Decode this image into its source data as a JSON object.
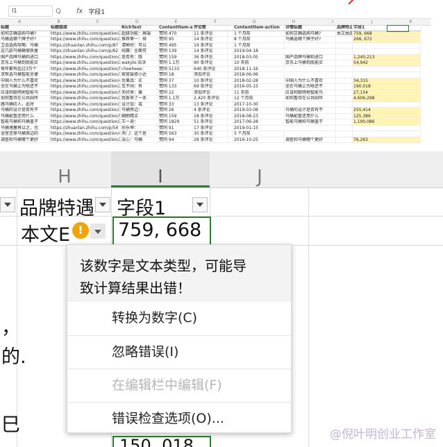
{
  "top": {
    "name_box": "I1",
    "fx_symbol": "fx",
    "fx_search": "Q",
    "formula_value": "字段1",
    "col_letters": [
      "A",
      "B",
      "C",
      "D",
      "E",
      "F",
      "G",
      "H",
      "I",
      "J",
      "K"
    ],
    "table_headers": [
      "标题",
      "标题链接",
      "RichText",
      "ContentItem-ac",
      "评论数",
      "",
      "ContentItem-action",
      "详情标题",
      "",
      "品牌特点",
      "字段1"
    ],
    "rows": [
      [
        "如何正确选购马桶?",
        "https://www.zhihu.com/question/2",
        "超级功能：高端",
        "赞同 470",
        "11 条评论",
        "",
        "1 个月前",
        "如何正确选购马桶?",
        "本文由品",
        "759, 668"
      ],
      [
        "马桶选哪个牌子好?",
        "https://www.zhihu.com/question/2",
        "推荐第一：排",
        "赞同 95",
        "14 条评论",
        "",
        "8 个月前",
        "马桶选哪个牌子好?",
        "",
        "266, 672"
      ],
      [
        "卫浴选购攻略：马桶",
        "https://zhuanlan.zhihu.com/p/87",
        "清晰时：可以",
        "赞同 495",
        "19 条评论",
        "",
        "1 个月前",
        "",
        "",
        ""
      ],
      [
        "这几款马桶确保质量",
        "https://zhuanlan.zhihu.com/p/62",
        "纯赛：全面可",
        "赞同 139",
        "14 条评论",
        "",
        "2019-04-18",
        "",
        "",
        ""
      ],
      [
        "国产品牌马桶和进口",
        "https://www.zhihu.com/question/3",
        "是否有：既",
        "赞同 159",
        "36 条评论",
        "",
        "2018-03-05",
        "国产品牌马桶和进口",
        "",
        "1,240,213"
      ],
      [
        "京东上马桶到底能买",
        "https://www.zhihu.com/question/2",
        "wakyto:告诉",
        "赞同 1.1万",
        "90 条评论",
        "",
        "10 天前",
        "京东上马桶到底能买",
        "",
        "54,942"
      ],
      [
        "每年都有超过3万个",
        "https://www.zhihu.com/question/50",
        "cheeheee：",
        "赞同 5133",
        "640 条评论",
        "",
        "2018-11-16",
        "",
        "",
        ""
      ],
      [
        "求帮选马桶智能坐便",
        "https://www.zhihu.com/question/37",
        "家居装修小达",
        "赞同 18",
        "添加评论",
        "",
        "2018-06-06",
        "",
        "",
        ""
      ],
      [
        "中国人为什么不喜欢",
        "https://www.zhihu.com/question/4",
        "优果品：买",
        "赞同 37",
        "10 条评论",
        "",
        "2018-02-28",
        "中国人为什么不喜欢",
        "",
        "34,315"
      ],
      [
        "坐在马桶上为啥还不",
        "https://www.zhihu.com/question/2",
        "车不闲：有",
        "赞同 133",
        "69 条评论",
        "",
        "2016-05-15",
        "坐在马桶上为啥还不",
        "",
        "190,018"
      ],
      [
        "应该和聪明地智能马",
        "https://www.zhihu.com/question/5",
        "天好来：展",
        "赞同 22",
        "添加评论",
        "",
        "11 天前",
        "应该和聪明地智能马",
        "",
        "27,154"
      ],
      [
        "如何看待在公共厕所",
        "https://www.zhihu.com/question/2",
        "我家来了一条",
        "赞同 1.1万",
        "2,420 条评论",
        "",
        "12 个月前",
        "如何看待在公共厕所",
        "",
        "4,606,298"
      ],
      [
        "路马桶防人，此时",
        "https://www.zhihu.com/question/3",
        "设计加：或",
        "赞同 33",
        "13 条评论",
        "",
        "2017-10-30",
        "",
        "",
        ""
      ],
      [
        "马桶的设计是否有不",
        "https://www.zhihu.com/question/3",
        "马桶旁边：",
        "赞同 26",
        "4 条评论",
        "",
        "2019-03-08",
        "马桶的设计是否有不",
        "",
        "255,414"
      ],
      [
        "马桶配置还用什么",
        "https://www.zhihu.com/question/5",
        "细胞精灵",
        "赞同 159",
        "18 条评论",
        "",
        "2018-08-23",
        "马桶配置还用什么",
        "",
        "125,386"
      ],
      [
        "智能马桶和马桶盖子",
        "https://www.zhihu.com/question/2",
        "王一迪：",
        "赞同 1829",
        "51 条评论",
        "",
        "2017-06-28",
        "智能马桶和马桶盖子",
        "",
        "1,190,086"
      ],
      [
        "马桶堵塞再以之，也",
        "https://zhuanlan.zhihu.com/p/54",
        "孙乐坤：",
        "赞同 91",
        "17 条评论",
        "",
        "2019-01-15",
        "",
        "",
        ""
      ],
      [
        "浴室还原马桶周边的",
        "https://www.zhihu.com/question/4",
        "天门：这个是",
        "赞同 563",
        "30 条评论",
        "",
        "5 个月前",
        "",
        "",
        ""
      ],
      [
        "调查和马桶哪个更好",
        "https://www.zhihu.com/question/2",
        "淡心：马桶",
        "赞同 94",
        "28 条评论",
        "",
        "2016-10-25",
        "调查和马桶哪个更好",
        "",
        "76,263"
      ]
    ]
  },
  "zoom": {
    "col_h": "H",
    "col_i": "I",
    "col_j": "J",
    "header_brand": "品牌特遇",
    "header_field": "字段1",
    "row2_brand": "本文E",
    "row2_field": "759, 668",
    "left_fragment_1": "，",
    "left_fragment_2": "的.",
    "left_fragment_3": "巳",
    "bottom_value": "150, 018",
    "warn_symbol": "!"
  },
  "popup": {
    "message_line1": "该数字是文本类型，可能导",
    "message_line2": "致计算结果出错！",
    "items": [
      {
        "label": "转换为数字(C)",
        "enabled": true
      },
      {
        "label": "忽略错误(I)",
        "enabled": true
      },
      {
        "label": "在编辑栏中编辑(F)",
        "enabled": false
      },
      {
        "label": "错误检查选项(O)...",
        "enabled": true
      }
    ]
  },
  "watermark": "@倪叶明创业工作室",
  "colors": {
    "selection_green": "#2e7d32",
    "warning_orange": "#f0a30a"
  }
}
